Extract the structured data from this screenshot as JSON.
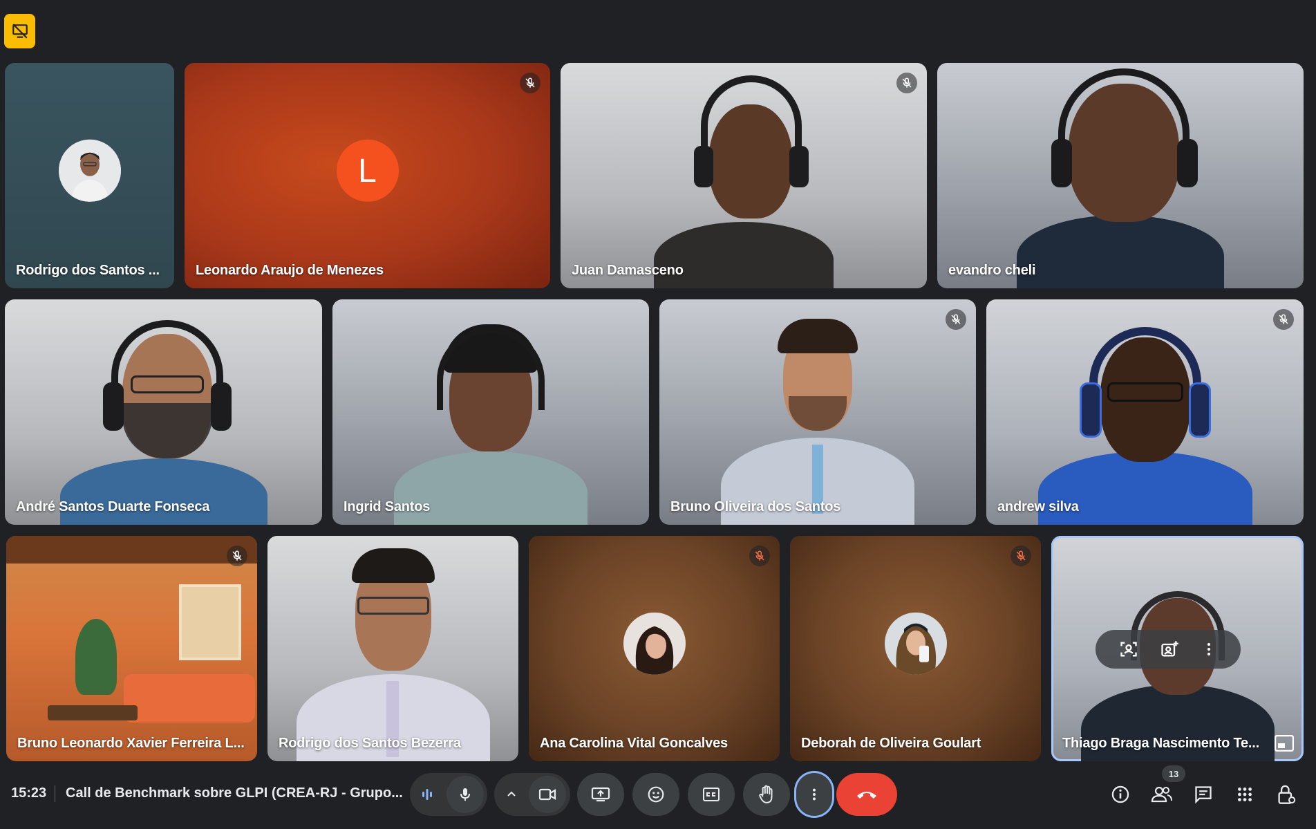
{
  "colors": {
    "background": "#202124",
    "accent": "#a8c7fa",
    "end_call": "#ea4335",
    "badge": "#fbbc04",
    "letter_avatar": "#f4511e"
  },
  "participants": [
    {
      "name": "Rodrigo dos Santos ...",
      "muted": false
    },
    {
      "name": "Leonardo Araujo de Menezes",
      "muted": true,
      "initial": "L"
    },
    {
      "name": "Juan Damasceno",
      "muted": true
    },
    {
      "name": "evandro cheli",
      "muted": false
    },
    {
      "name": "André Santos Duarte Fonseca",
      "muted": false
    },
    {
      "name": "Ingrid Santos",
      "muted": false
    },
    {
      "name": "Bruno Oliveira dos Santos",
      "muted": true
    },
    {
      "name": "andrew silva",
      "muted": true
    },
    {
      "name": "Bruno Leonardo Xavier Ferreira L...",
      "muted": true
    },
    {
      "name": "Rodrigo dos Santos Bezerra",
      "muted": false
    },
    {
      "name": "Ana Carolina Vital Goncalves",
      "muted": true
    },
    {
      "name": "Deborah de Oliveira Goulart",
      "muted": true
    },
    {
      "name": "Thiago Braga Nascimento Te...",
      "muted": false,
      "selected": true
    }
  ],
  "bottom_bar": {
    "time": "15:23",
    "meeting_title": "Call de Benchmark sobre GLPI (CREA-RJ - Grupo...",
    "participant_count": "13"
  },
  "icons": [
    "presentation-off-icon",
    "mic-off-icon",
    "audio-level-icon",
    "mic-icon",
    "chevron-up-icon",
    "camera-icon",
    "present-screen-icon",
    "emoji-icon",
    "captions-icon",
    "raise-hand-icon",
    "more-vert-icon",
    "end-call-icon",
    "info-icon",
    "people-icon",
    "chat-icon",
    "apps-icon",
    "host-controls-icon",
    "frame-person-icon",
    "add-photo-icon",
    "pip-icon"
  ]
}
